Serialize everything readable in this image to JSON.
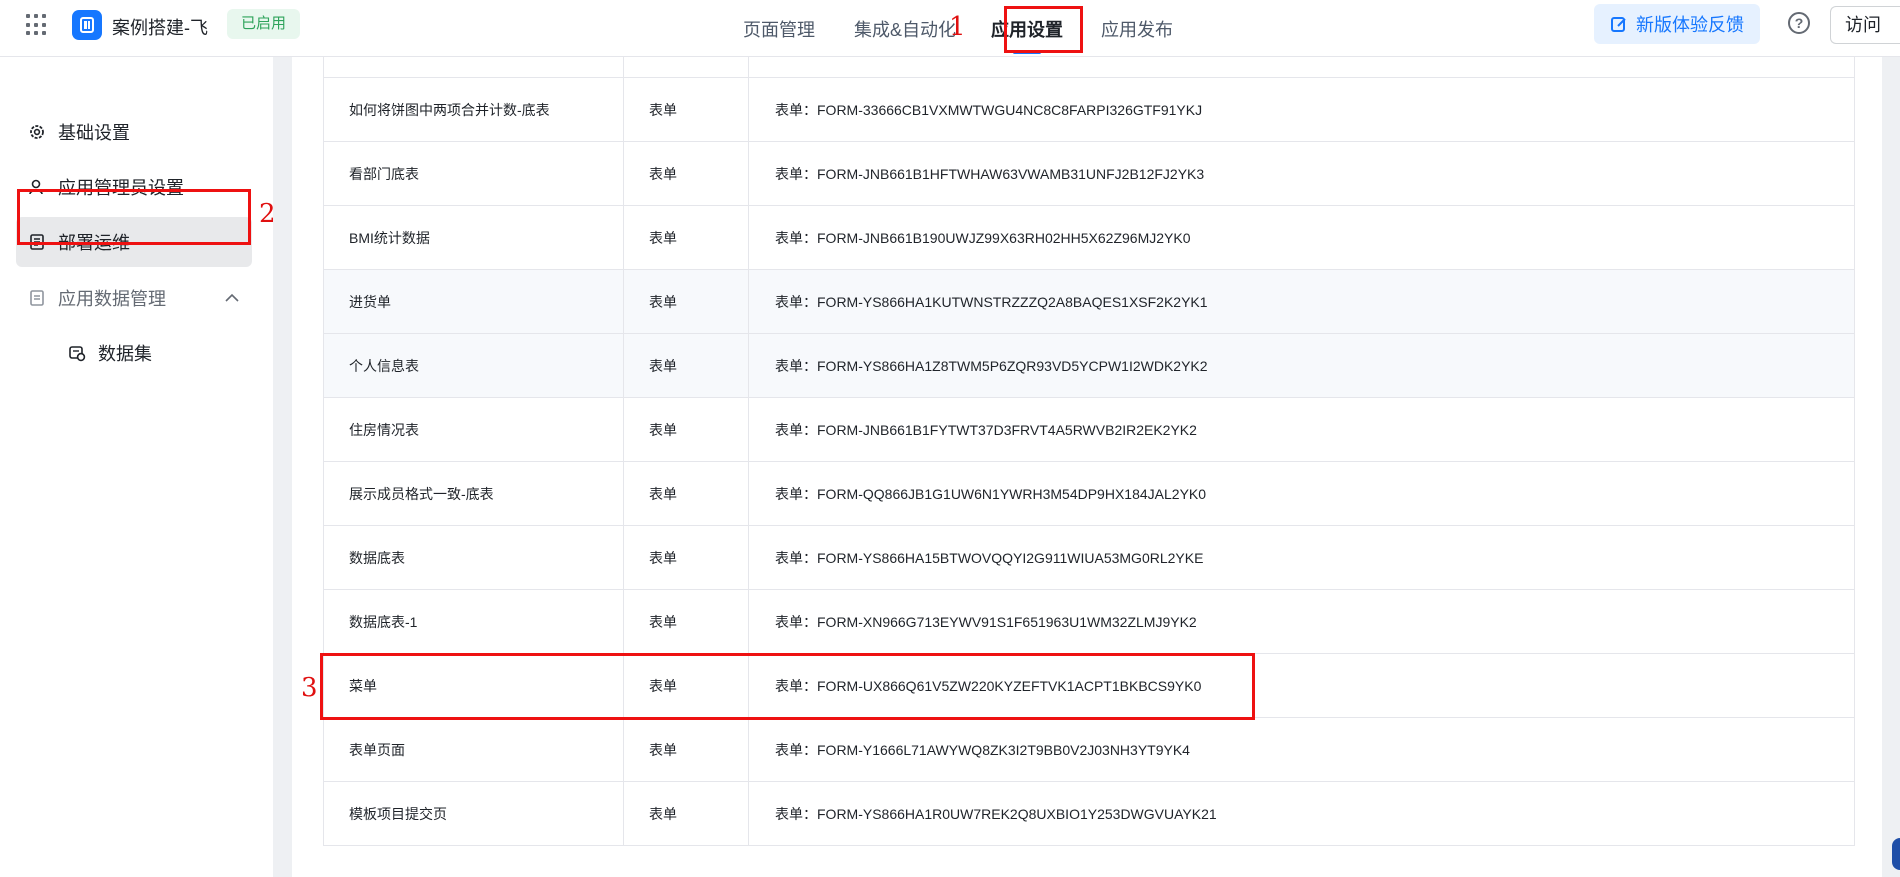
{
  "header": {
    "app_name": "案例搭建-飞",
    "status": "已启用",
    "tabs": [
      {
        "label": "页面管理"
      },
      {
        "label": "集成&自动化"
      },
      {
        "label": "应用设置"
      },
      {
        "label": "应用发布"
      }
    ],
    "active_tab": "应用设置",
    "feedback_label": "新版体验反馈",
    "visit_label": "访问"
  },
  "sidebar": {
    "items": [
      {
        "label": "基础设置",
        "icon": "gear-icon"
      },
      {
        "label": "应用管理员设置",
        "icon": "user-icon"
      },
      {
        "label": "部署运维",
        "icon": "deploy-icon"
      },
      {
        "label": "应用数据管理",
        "icon": "document-icon"
      },
      {
        "label": "数据集",
        "icon": "dataset-icon"
      }
    ],
    "active_item": "部署运维"
  },
  "table": {
    "rows": [
      {
        "name": "如何将饼图中两项合并计数-底表",
        "type": "表单",
        "code": "表单：FORM-33666CB1VXMWTWGU4NC8C8FARPI326GTF91YKJ"
      },
      {
        "name": "看部门底表",
        "type": "表单",
        "code": "表单：FORM-JNB661B1HFTWHAW63VWAMB31UNFJ2B12FJ2YK3"
      },
      {
        "name": "BMI统计数据",
        "type": "表单",
        "code": "表单：FORM-JNB661B190UWJZ99X63RH02HH5X62Z96MJ2YK0"
      },
      {
        "name": "进货单",
        "type": "表单",
        "code": "表单：FORM-YS866HA1KUTWNSTRZZZQ2A8BAQES1XSF2K2YK1"
      },
      {
        "name": "个人信息表",
        "type": "表单",
        "code": "表单：FORM-YS866HA1Z8TWM5P6ZQR93VD5YCPW1I2WDK2YK2"
      },
      {
        "name": "住房情况表",
        "type": "表单",
        "code": "表单：FORM-JNB661B1FYTWT37D3FRVT4A5RWVB2IR2EK2YK2"
      },
      {
        "name": "展示成员格式一致-底表",
        "type": "表单",
        "code": "表单：FORM-QQ866JB1G1UW6N1YWRH3M54DP9HX184JAL2YK0"
      },
      {
        "name": "数据底表",
        "type": "表单",
        "code": "表单：FORM-YS866HA15BTWOVQQYI2G911WIUA53MG0RL2YKE"
      },
      {
        "name": "数据底表-1",
        "type": "表单",
        "code": "表单：FORM-XN966G713EYWV91S1F651963U1WM32ZLMJ9YK2"
      },
      {
        "name": "菜单",
        "type": "表单",
        "code": "表单：FORM-UX866Q61V5ZW220KYZEFTVK1ACPT1BKBCS9YK0"
      },
      {
        "name": "表单页面",
        "type": "表单",
        "code": "表单：FORM-Y1666L71AWYWQ8ZK3I2T9BB0V2J03NH3YT9YK4"
      },
      {
        "name": "模板项目提交页",
        "type": "表单",
        "code": "表单：FORM-YS866HA1R0UW7REK2Q8UXBIO1Y253DWGVUAYK21"
      }
    ]
  },
  "annotations": [
    "1",
    "2",
    "3"
  ]
}
